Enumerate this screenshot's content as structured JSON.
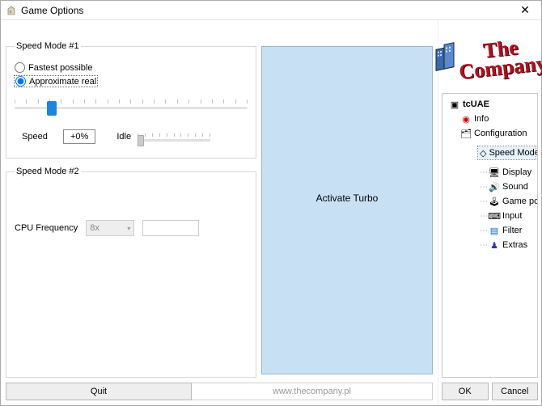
{
  "window": {
    "title": "Game Options"
  },
  "speedMode1": {
    "legend": "Speed Mode #1",
    "optFastest": "Fastest possible",
    "optApprox": "Approximate real",
    "selected": "approx",
    "speedLabel": "Speed",
    "speedValue": "+0%",
    "idleLabel": "Idle",
    "sliderPercent": 16
  },
  "speedMode2": {
    "legend": "Speed Mode #2",
    "cpuFreqLabel": "CPU Frequency",
    "cpuFreqValue": "8x",
    "cpuFreqText": ""
  },
  "turbo": {
    "label": "Activate Turbo"
  },
  "footer": {
    "quit": "Quit",
    "url": "www.thecompany.pl"
  },
  "logo": {
    "line1": "The",
    "line2": "Company"
  },
  "tree": {
    "root": "tcUAE",
    "info": "Info",
    "config": "Configuration",
    "speed": "Speed Mode",
    "display": "Display",
    "sound": "Sound",
    "gameports": "Game ports",
    "input": "Input",
    "filter": "Filter",
    "extras": "Extras"
  },
  "buttons": {
    "ok": "OK",
    "cancel": "Cancel"
  }
}
